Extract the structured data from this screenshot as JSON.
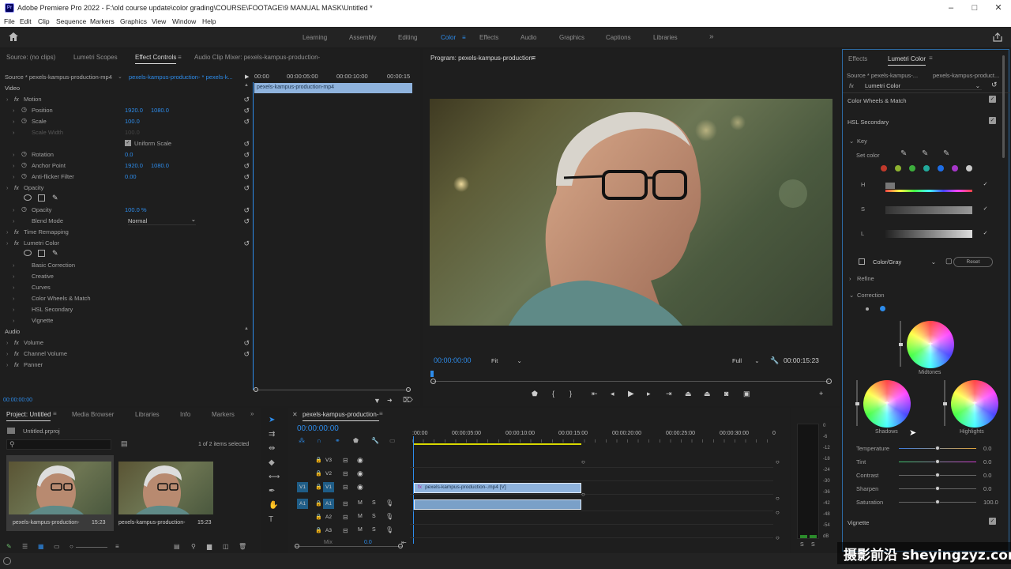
{
  "window": {
    "title": "Adobe Premiere Pro 2022 - F:\\old course update\\color grading\\COURSE\\FOOTAGE\\9 MANUAL MASK\\Untitled *",
    "logo": "Pr",
    "controls": [
      "minimize-icon",
      "maximize-icon",
      "close-icon"
    ]
  },
  "menu": [
    "File",
    "Edit",
    "Clip",
    "Sequence",
    "Markers",
    "Graphics",
    "View",
    "Window",
    "Help"
  ],
  "workspaces": {
    "items": [
      "Learning",
      "Assembly",
      "Editing",
      "Color",
      "Effects",
      "Audio",
      "Graphics",
      "Captions",
      "Libraries"
    ],
    "active": "Color",
    "more": "»"
  },
  "source_panel": {
    "tabs": [
      "Source: (no clips)",
      "Lumetri Scopes",
      "Effect Controls",
      "Audio Clip Mixer: pexels-kampus-production-"
    ],
    "active_tab": "Effect Controls",
    "source_label": "Source * pexels-kampus-production-mp4",
    "sequence_label": "pexels-kampus-production- * pexels-k...",
    "ruler": [
      "00:00",
      "00:00:05:00",
      "00:00:10:00",
      "00:00:15"
    ],
    "clip_label": "pexels-kampus-production-mp4",
    "timecode": "00:00:00:00",
    "rows": [
      {
        "name": "Video",
        "indent": 0,
        "type": "header"
      },
      {
        "name": "Motion",
        "indent": 1,
        "fx": true,
        "reset": true
      },
      {
        "name": "Position",
        "indent": 2,
        "v1": "1920.0",
        "v2": "1080.0",
        "stopwatch": true,
        "reset": true
      },
      {
        "name": "Scale",
        "indent": 2,
        "v1": "100.0",
        "stopwatch": true,
        "reset": true
      },
      {
        "name": "Scale Width",
        "indent": 2,
        "v1": "100.0",
        "dim": true
      },
      {
        "name": "Uniform Scale",
        "indent": 2,
        "checkbox": true,
        "reset": true
      },
      {
        "name": "Rotation",
        "indent": 2,
        "v1": "0.0",
        "stopwatch": true,
        "reset": true
      },
      {
        "name": "Anchor Point",
        "indent": 2,
        "v1": "1920.0",
        "v2": "1080.0",
        "stopwatch": true,
        "reset": true
      },
      {
        "name": "Anti-flicker Filter",
        "indent": 2,
        "v1": "0.00",
        "stopwatch": true,
        "reset": true
      },
      {
        "name": "Opacity",
        "indent": 1,
        "fx": true,
        "reset": true
      },
      {
        "name": "",
        "indent": 2,
        "masks": true
      },
      {
        "name": "Opacity",
        "indent": 2,
        "v1": "100.0 %",
        "stopwatch": true,
        "reset": true
      },
      {
        "name": "Blend Mode",
        "indent": 2,
        "dropdown": "Normal",
        "reset": true
      },
      {
        "name": "Time Remapping",
        "indent": 1,
        "fx": true
      },
      {
        "name": "Lumetri Color",
        "indent": 1,
        "fx": true,
        "reset": true
      },
      {
        "name": "",
        "indent": 2,
        "masks": true
      },
      {
        "name": "Basic Correction",
        "indent": 2
      },
      {
        "name": "Creative",
        "indent": 2
      },
      {
        "name": "Curves",
        "indent": 2
      },
      {
        "name": "Color Wheels & Match",
        "indent": 2
      },
      {
        "name": "HSL Secondary",
        "indent": 2
      },
      {
        "name": "Vignette",
        "indent": 2
      },
      {
        "name": "Audio",
        "indent": 0,
        "type": "header"
      },
      {
        "name": "Volume",
        "indent": 1,
        "fx": true,
        "reset": true
      },
      {
        "name": "Channel Volume",
        "indent": 1,
        "fx": true,
        "reset": true
      },
      {
        "name": "Panner",
        "indent": 1,
        "fx": true
      }
    ]
  },
  "program_monitor": {
    "title": "Program: pexels-kampus-production-",
    "timecode": "00:00:00:00",
    "fit": "Fit",
    "quality": "Full",
    "duration": "00:00:15:23",
    "transport": [
      "add-marker-icon",
      "mark-in-icon",
      "mark-out-icon",
      "go-to-in-icon",
      "step-back-icon",
      "play-icon",
      "step-forward-icon",
      "go-to-out-icon",
      "lift-icon",
      "extract-icon",
      "export-frame-icon",
      "compare-icon",
      "add-button-icon"
    ]
  },
  "project_panel": {
    "tabs": [
      "Project: Untitled",
      "Media Browser",
      "Libraries",
      "Info",
      "Markers"
    ],
    "active_tab": "Project: Untitled",
    "file": "Untitled.prproj",
    "search_placeholder": "",
    "selection": "1 of 2 items selected",
    "items": [
      {
        "name": "pexels-kampus-production-",
        "duration": "15:23",
        "selected": true
      },
      {
        "name": "pexels-kampus-production-",
        "duration": "15:23",
        "selected": false
      }
    ]
  },
  "timeline": {
    "tab": "pexels-kampus-production-",
    "timecode": "00:00:00:00",
    "ruler": [
      ":00:00",
      "00:00:05:00",
      "00:00:10:00",
      "00:00:15:00",
      "00:00:20:00",
      "00:00:25:00",
      "00:00:30:00",
      "0"
    ],
    "tracks": [
      {
        "id": "V3",
        "kind": "video",
        "src": ""
      },
      {
        "id": "V2",
        "kind": "video",
        "src": ""
      },
      {
        "id": "V1",
        "kind": "video",
        "src": "V1",
        "clip": "pexels-kampus-production-.mp4 [V]"
      },
      {
        "id": "A1",
        "kind": "audio",
        "src": "A1",
        "clip": ""
      },
      {
        "id": "A2",
        "kind": "audio",
        "src": ""
      },
      {
        "id": "A3",
        "kind": "audio",
        "src": ""
      }
    ],
    "mix_label": "Mix",
    "mix_value": "0.0"
  },
  "meter": {
    "ticks": [
      "0",
      "-6",
      "-12",
      "-18",
      "-24",
      "-30",
      "-36",
      "-42",
      "-48",
      "-54",
      "dB"
    ],
    "solo": [
      "S",
      "S"
    ]
  },
  "lumetri": {
    "tabs": [
      "Effects",
      "Lumetri Color"
    ],
    "active_tab": "Lumetri Color",
    "source": "Source * pexels-kampus-...",
    "sequence": "pexels-kampus-product...",
    "effect": "Lumetri Color",
    "sections": {
      "color_wheels": "Color Wheels & Match",
      "hsl": "HSL Secondary",
      "key": "Key",
      "set_color": "Set color",
      "h": "H",
      "s": "S",
      "l": "L",
      "mode": "Color/Gray",
      "reset": "Reset",
      "refine": "Refine",
      "correction": "Correction",
      "vignette": "Vignette"
    },
    "swatches": [
      "#c0392b",
      "#8db230",
      "#3dae3d",
      "#22a99b",
      "#1e6ee6",
      "#a637c9",
      "#c9c9c9"
    ],
    "wheels": {
      "midtones": "Midtones",
      "shadows": "Shadows",
      "highlights": "Highlights"
    },
    "sliders": [
      {
        "name": "Temperature",
        "value": "0.0",
        "pos": 0.5,
        "gradient": "linear-gradient(90deg,#3a7be0,#e0a33a)"
      },
      {
        "name": "Tint",
        "value": "0.0",
        "pos": 0.5,
        "gradient": "linear-gradient(90deg,#3ac46a,#d03ad0)"
      },
      {
        "name": "Contrast",
        "value": "0.0",
        "pos": 0.5,
        "gradient": "linear-gradient(90deg,#666,#666)"
      },
      {
        "name": "Sharpen",
        "value": "0.0",
        "pos": 0.5,
        "gradient": "linear-gradient(90deg,#666,#666)"
      },
      {
        "name": "Saturation",
        "value": "100.0",
        "pos": 0.5,
        "gradient": "linear-gradient(90deg,#666,#666)"
      }
    ]
  },
  "watermark": "摄影前沿 sheyingzyz.com",
  "colors": {
    "accent": "#2d8ceb",
    "clip_video": "#8fb3dd",
    "clip_audio": "#7aa0c8",
    "playhead": "#2d8ceb",
    "yellow_bar": "#d8d800"
  }
}
